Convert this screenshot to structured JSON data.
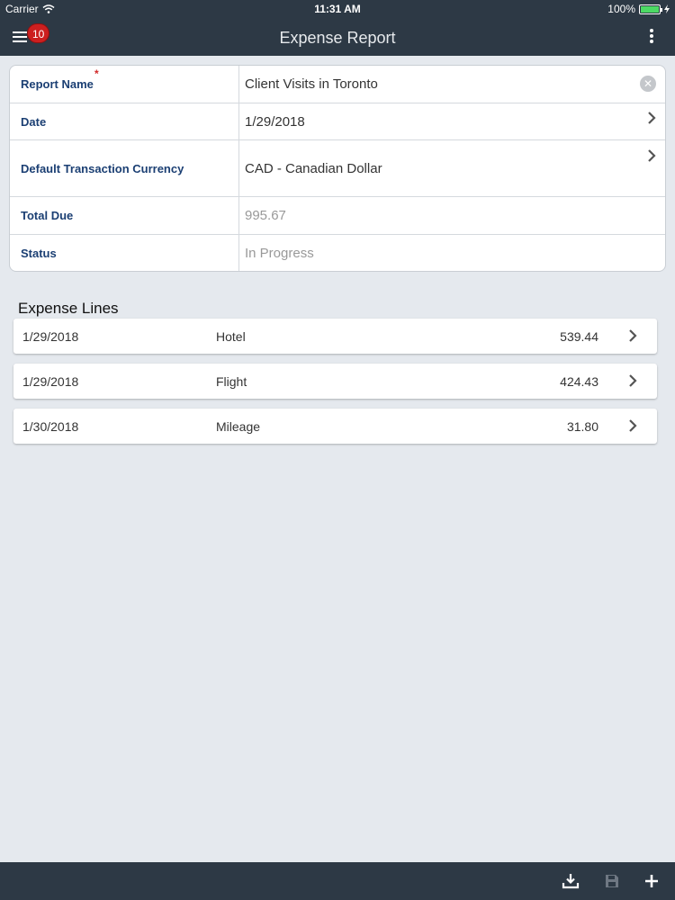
{
  "status_bar": {
    "carrier": "Carrier",
    "time": "11:31 AM",
    "battery": "100%"
  },
  "header": {
    "title": "Expense Report",
    "badge_count": "10"
  },
  "form": {
    "report_name": {
      "label": "Report Name",
      "value": "Client Visits in Toronto",
      "required_mark": "*"
    },
    "date": {
      "label": "Date",
      "value": "1/29/2018"
    },
    "currency": {
      "label": "Default Transaction Currency",
      "value": "CAD - Canadian Dollar"
    },
    "total_due": {
      "label": "Total Due",
      "value": "995.67"
    },
    "status": {
      "label": "Status",
      "value": "In Progress"
    }
  },
  "expense_lines": {
    "title": "Expense Lines",
    "items": [
      {
        "date": "1/29/2018",
        "type": "Hotel",
        "amount": "539.44"
      },
      {
        "date": "1/29/2018",
        "type": "Flight",
        "amount": "424.43"
      },
      {
        "date": "1/30/2018",
        "type": "Mileage",
        "amount": "31.80"
      }
    ]
  },
  "icons": {
    "clear": "clear-icon",
    "chevron": "chevron-right-icon",
    "download": "download-icon",
    "save": "save-icon",
    "add": "plus-icon"
  },
  "colors": {
    "bar_background": "#2d3945",
    "label_text": "#1b3f73",
    "badge": "#cc1f1f",
    "page_background": "#e5e9ee"
  }
}
